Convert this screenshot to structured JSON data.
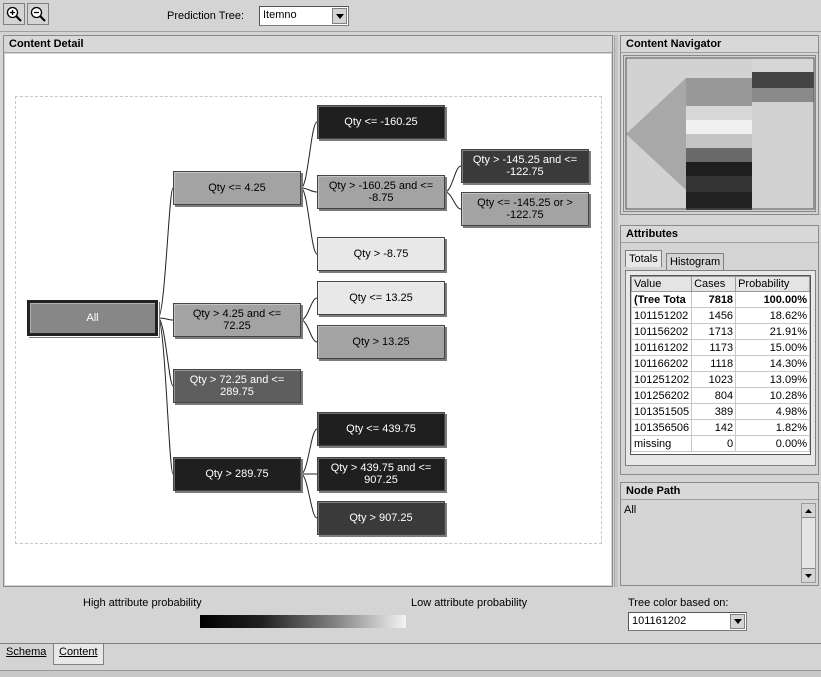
{
  "toolbar": {
    "zoom_in_icon": "zoom-in-icon",
    "zoom_out_icon": "zoom-out-icon",
    "prediction_tree_label": "Prediction Tree:",
    "prediction_tree_value": "Itemno"
  },
  "content_detail": {
    "title": "Content Detail",
    "nodes": {
      "all": "All",
      "qty_le_4_25": "Qty <= 4.25",
      "qty_4_25_72_25": "Qty > 4.25 and <= 72.25",
      "qty_72_25_289_75": "Qty > 72.25 and <= 289.75",
      "qty_gt_289_75": "Qty > 289.75",
      "qty_le_neg160_25": "Qty <= -160.25",
      "qty_neg160_25_neg8_75": "Qty > -160.25 and <= -8.75",
      "qty_gt_neg8_75": "Qty > -8.75",
      "qty_neg145_25_neg122_75": "Qty > -145.25 and <= -122.75",
      "qty_le_neg145_25_or": "Qty <= -145.25 or > -122.75",
      "qty_le_13_25": "Qty <= 13.25",
      "qty_gt_13_25": "Qty > 13.25",
      "qty_le_439_75": "Qty <= 439.75",
      "qty_439_75_907_25": "Qty > 439.75 and <= 907.25",
      "qty_gt_907_25": "Qty > 907.25"
    }
  },
  "content_navigator": {
    "title": "Content Navigator"
  },
  "attributes": {
    "title": "Attributes",
    "tabs": [
      "Totals",
      "Histogram"
    ],
    "columns": [
      "Value",
      "Cases",
      "Probability"
    ],
    "rows": [
      {
        "value": "(Tree Tota",
        "cases": "7818",
        "probability": "100.00%"
      },
      {
        "value": "101151202",
        "cases": "1456",
        "probability": "18.62%"
      },
      {
        "value": "101156202",
        "cases": "1713",
        "probability": "21.91%"
      },
      {
        "value": "101161202",
        "cases": "1173",
        "probability": "15.00%"
      },
      {
        "value": "101166202",
        "cases": "1118",
        "probability": "14.30%"
      },
      {
        "value": "101251202",
        "cases": "1023",
        "probability": "13.09%"
      },
      {
        "value": "101256202",
        "cases": "804",
        "probability": "10.28%"
      },
      {
        "value": "101351505",
        "cases": "389",
        "probability": "4.98%"
      },
      {
        "value": "101356506",
        "cases": "142",
        "probability": "1.82%"
      },
      {
        "value": "missing",
        "cases": "0",
        "probability": "0.00%"
      }
    ]
  },
  "node_path": {
    "title": "Node Path",
    "value": "All"
  },
  "legend": {
    "high_label": "High attribute probability",
    "low_label": "Low attribute probability",
    "tree_color_label": "Tree color based on:",
    "tree_color_value": "101161202"
  },
  "bottom_tabs": [
    "Schema",
    "Content"
  ],
  "colors": {
    "background": "#d4d4d4",
    "canvas": "#ffffff"
  }
}
